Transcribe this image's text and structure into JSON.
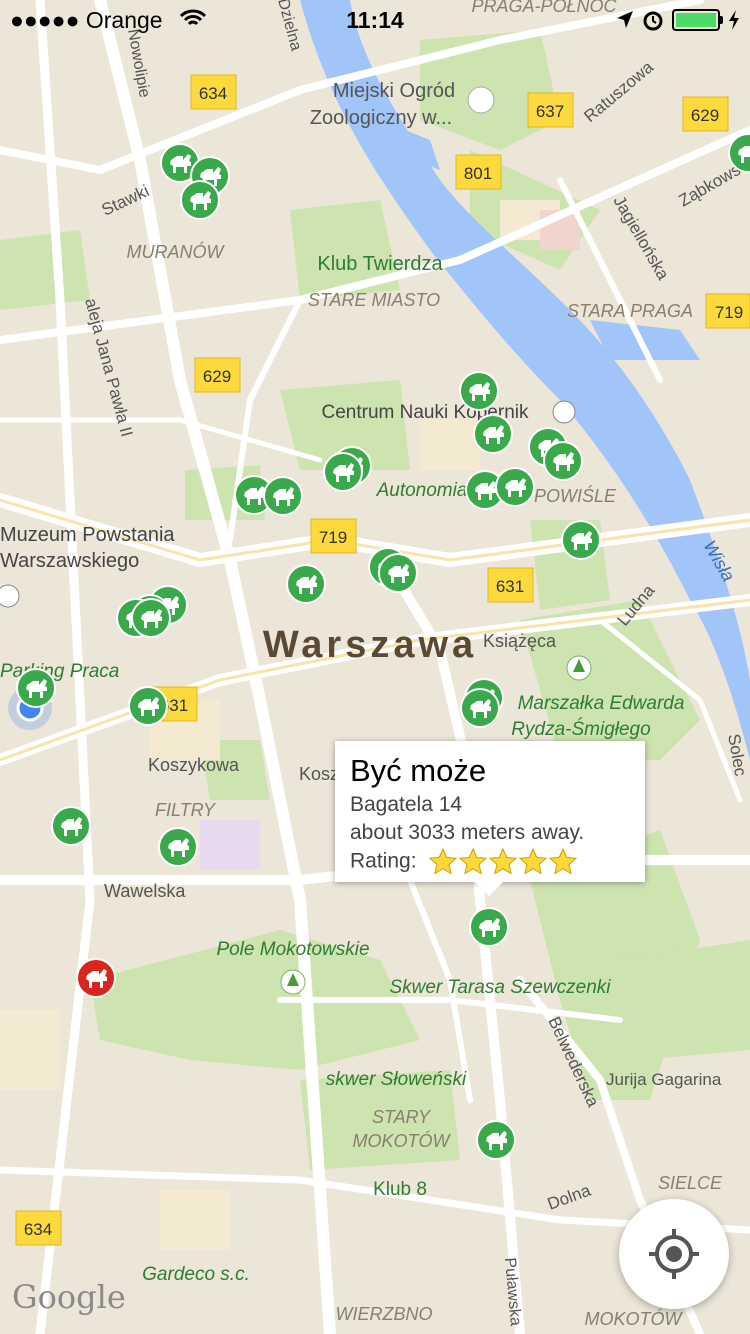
{
  "status_bar": {
    "carrier": "●●●●● Orange",
    "time": "11:14",
    "battery_color": "#4cd964"
  },
  "map": {
    "city_label": "Warszawa",
    "district_labels": [
      "MURANÓW",
      "STARE MIASTO",
      "STARA PRAGA",
      "POWIŚLE",
      "FILTRY",
      "STARY",
      "MOKOTÓW",
      "SIELCE",
      "WIERZBNO",
      "MOKOTÓW",
      "PRAGA-PÓŁNOC"
    ],
    "place_labels": [
      "Miejski Ogród",
      "Zoologiczny w...",
      "Klub Twierdza",
      "Centrum Nauki Kopernik",
      "Autonomia",
      "Muzeum Powstania",
      "Warszawskiego",
      "Parking Praca",
      "Książęca",
      "Marszałka Edwarda",
      "Rydza-Śmigłego",
      "Koszykowa",
      "Kosz",
      "Wawelska",
      "Pole Mokotowskie",
      "Skwer Tarasa Szewczenki",
      "skwer Słoweński",
      "Klub 8",
      "Gardeco s.c.",
      "Jurija Gagarina",
      "Dolna",
      "Belwederska",
      "Puławska",
      "Ludna",
      "Wisła",
      "Solec",
      "Ratuszowa",
      "Jagiellońska",
      "Ząbkowska",
      "Stawki",
      "aleja Jana Pawła II",
      "Nowolipie",
      "Dzielna"
    ],
    "road_shields": [
      "634",
      "637",
      "629",
      "801",
      "719",
      "629",
      "719",
      "631",
      "631",
      "634"
    ],
    "attribution": "Google",
    "colors": {
      "land": "#ece6d9",
      "park": "#cde3b0",
      "water": "#a1c4f9",
      "road": "#ffffff",
      "shield": "#fcd93c",
      "marker_green": "#3aa94c",
      "marker_red": "#d9251d",
      "user_dot": "#4285f4"
    }
  },
  "callout": {
    "title": "Być może",
    "address": "Bagatela 14",
    "distance": "about 3033 meters away.",
    "rating_label": "Rating:",
    "rating": 5,
    "rating_max": 5
  },
  "locate_button": {
    "icon": "crosshair-location-icon"
  }
}
